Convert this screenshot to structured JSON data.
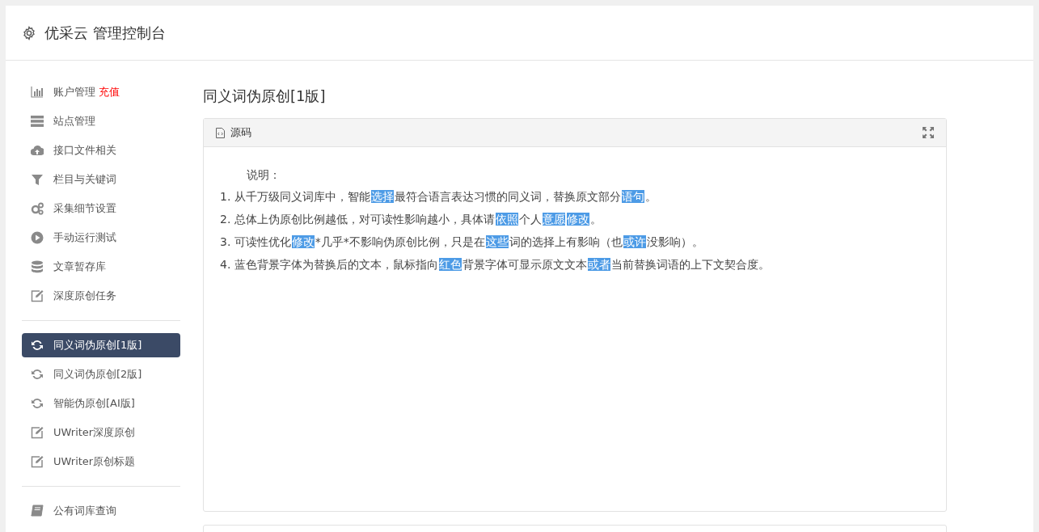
{
  "header": {
    "title": "优采云 管理控制台"
  },
  "sidebar": {
    "groups": [
      {
        "items": [
          {
            "label": "账户管理",
            "badge": "充值",
            "selected": false
          },
          {
            "label": "站点管理",
            "selected": false
          },
          {
            "label": "接口文件相关",
            "selected": false
          },
          {
            "label": "栏目与关键词",
            "selected": false
          },
          {
            "label": "采集细节设置",
            "selected": false
          },
          {
            "label": "手动运行测试",
            "selected": false
          },
          {
            "label": "文章暂存库",
            "selected": false
          },
          {
            "label": "深度原创任务",
            "selected": false
          }
        ]
      },
      {
        "items": [
          {
            "label": "同义词伪原创[1版]",
            "selected": true
          },
          {
            "label": "同义词伪原创[2版]",
            "selected": false
          },
          {
            "label": "智能伪原创[AI版]",
            "selected": false
          },
          {
            "label": "UWriter深度原创",
            "selected": false
          },
          {
            "label": "UWriter原创标题",
            "selected": false
          }
        ]
      },
      {
        "items": [
          {
            "label": "公有词库查询",
            "selected": false
          }
        ]
      }
    ]
  },
  "page_title": "同义词伪原创[1版]",
  "panel": {
    "title": "源码",
    "intro": "说明：",
    "lines": [
      [
        {
          "text": "1. 从千万级同义词库中，智能",
          "highlight": false
        },
        {
          "text": "选择",
          "highlight": true
        },
        {
          "text": "最符合语言表达习惯的同义词，替换原文部分",
          "highlight": false
        },
        {
          "text": "语句",
          "highlight": true
        },
        {
          "text": "。",
          "highlight": false
        }
      ],
      [
        {
          "text": "2. 总体上伪原创比例越低，对可读性影响越小，具体请",
          "highlight": false
        },
        {
          "text": "依照",
          "highlight": true
        },
        {
          "text": "个人",
          "highlight": false
        },
        {
          "text": "意愿",
          "highlight": true
        },
        {
          "text": "修改",
          "highlight": true
        },
        {
          "text": "。",
          "highlight": false
        }
      ],
      [
        {
          "text": "3. 可读性优化",
          "highlight": false
        },
        {
          "text": "修改",
          "highlight": true
        },
        {
          "text": "*几乎*不影响伪原创比例，只是在",
          "highlight": false
        },
        {
          "text": "这些",
          "highlight": true
        },
        {
          "text": "词的选择上有影响（也",
          "highlight": false
        },
        {
          "text": "或许",
          "highlight": true
        },
        {
          "text": "没影响）。",
          "highlight": false
        }
      ],
      [
        {
          "text": "4. 蓝色背景字体为替换后的文本，鼠标指向",
          "highlight": false
        },
        {
          "text": "红色",
          "highlight": true
        },
        {
          "text": "背景字体可显示原文文本",
          "highlight": false
        },
        {
          "text": "或者",
          "highlight": true
        },
        {
          "text": "当前替换词语的上下文契合度。",
          "highlight": false
        }
      ]
    ]
  }
}
